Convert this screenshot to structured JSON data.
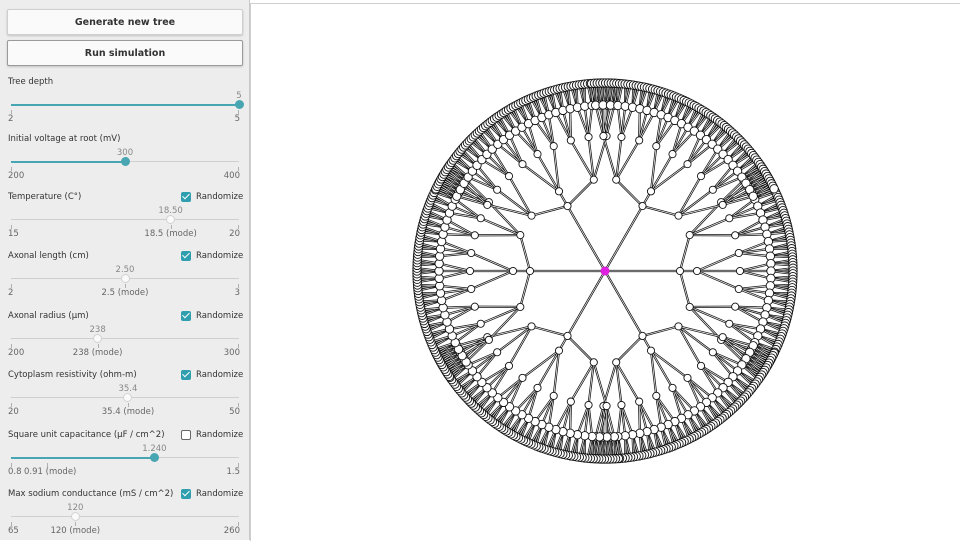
{
  "buttons": {
    "generate": "Generate new tree",
    "run": "Run simulation"
  },
  "randomize_label": "Randomize",
  "controls": [
    {
      "label": "Tree depth",
      "value": "5",
      "min": "2",
      "max": "5",
      "fraction": 1.0,
      "randomize": null,
      "mode_label": null
    },
    {
      "label": "Initial voltage at root (mV)",
      "value": "300",
      "min": "200",
      "max": "400",
      "fraction": 0.5,
      "randomize": null,
      "mode_label": null
    },
    {
      "label": "Temperature (C°)",
      "value": "18.50",
      "min": "15",
      "max": "20",
      "fraction": 0.7,
      "randomize": true,
      "mode_label": "18.5 (mode)"
    },
    {
      "label": "Axonal length (cm)",
      "value": "2.50",
      "min": "2",
      "max": "3",
      "fraction": 0.5,
      "randomize": true,
      "mode_label": "2.5 (mode)"
    },
    {
      "label": "Axonal radius (μm)",
      "value": "238",
      "min": "200",
      "max": "300",
      "fraction": 0.38,
      "randomize": true,
      "mode_label": "238 (mode)"
    },
    {
      "label": "Cytoplasm resistivity (ohm-m)",
      "value": "35.4",
      "min": "20",
      "max": "50",
      "fraction": 0.513,
      "randomize": true,
      "mode_label": "35.4 (mode)"
    },
    {
      "label": "Square unit capacitance (μF / cm^2)",
      "value": "1.240",
      "min": "0.8",
      "max": "1.5",
      "fraction": 0.629,
      "randomize": false,
      "mode_label": "0.91 (mode)",
      "mode_fraction": 0.157
    },
    {
      "label": "Max sodium conductance (mS / cm^2)",
      "value": "120",
      "min": "65",
      "max": "260",
      "fraction": 0.282,
      "randomize": true,
      "mode_label": "120 (mode)"
    }
  ],
  "colors": {
    "accent": "#48a6b3",
    "checkbox": "#2f9fb0",
    "root_node": "#e020e0",
    "tree_line": "#111111"
  },
  "tree": {
    "depth": 5,
    "branching": 3
  }
}
